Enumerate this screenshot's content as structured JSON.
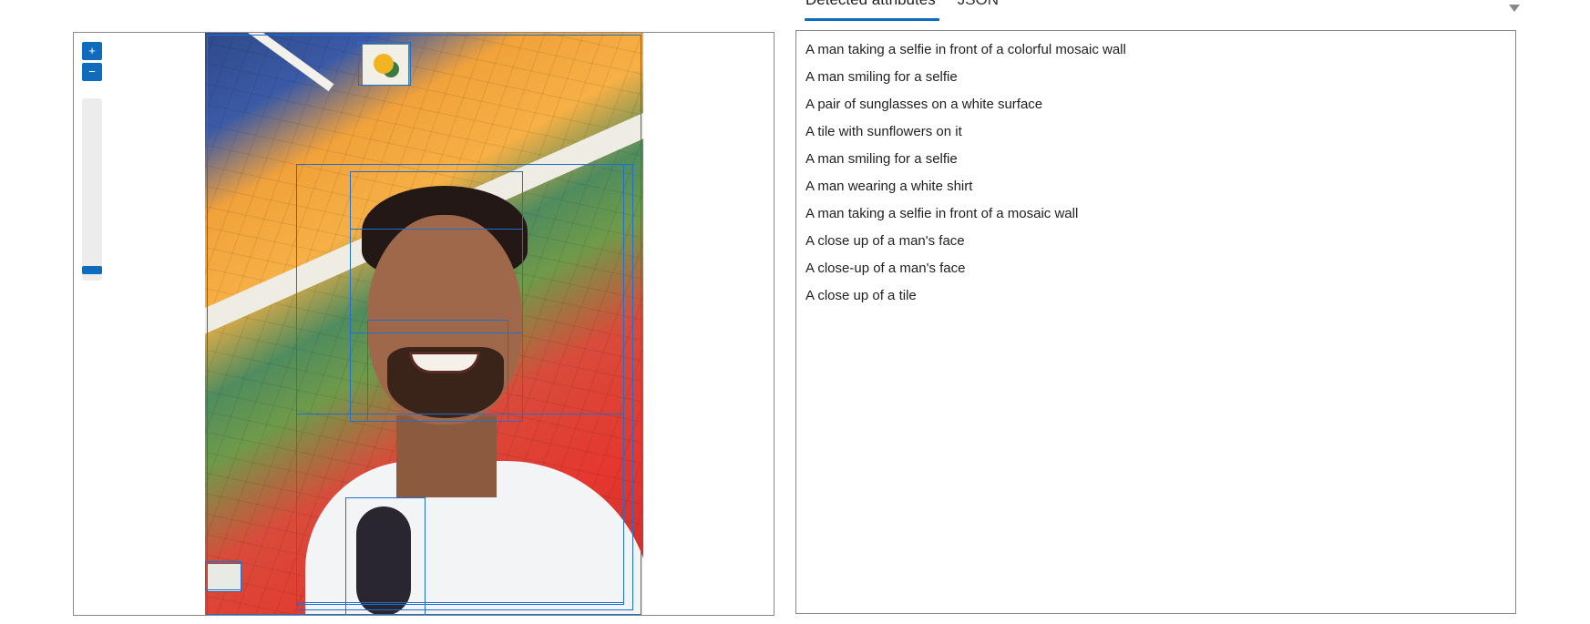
{
  "tabs": [
    {
      "label": "Detected attributes",
      "active": true
    },
    {
      "label": "JSON",
      "active": false
    }
  ],
  "viewer": {
    "zoom_in_label": "+",
    "zoom_out_label": "−",
    "zoom_level_fraction": 0.0,
    "accent_color": "#0f6cbd",
    "bbox_color": "#1f6fd1"
  },
  "results": [
    "A man taking a selfie in front of a colorful mosaic wall",
    "A man smiling for a selfie",
    "A pair of sunglasses on a white surface",
    "A tile with sunflowers on it",
    "A man smiling for a selfie",
    "A man wearing a white shirt",
    "A man taking a selfie in front of a mosaic wall",
    "A close up of a man's face",
    "A close-up of a man's face",
    "A close up of a tile"
  ]
}
